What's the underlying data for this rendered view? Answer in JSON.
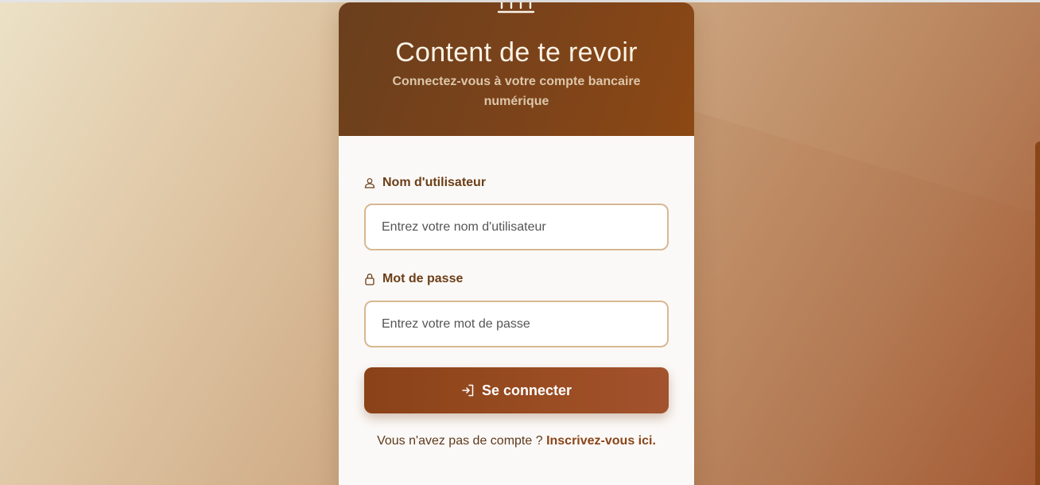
{
  "colors": {
    "accent": "#8a4518",
    "header_start": "#6a3f1d",
    "header_end": "#8c4814",
    "input_border": "#d8b892",
    "label_text": "#6b3e17"
  },
  "header": {
    "icon": "bank-icon",
    "title": "Content de te revoir",
    "subtitle": "Connectez-vous à votre compte bancaire numérique"
  },
  "form": {
    "username": {
      "icon": "user-icon",
      "label": "Nom d'utilisateur",
      "placeholder": "Entrez votre nom d'utilisateur",
      "value": ""
    },
    "password": {
      "icon": "lock-icon",
      "label": "Mot de passe",
      "placeholder": "Entrez votre mot de passe",
      "value": ""
    },
    "submit": {
      "icon": "login-icon",
      "label": "Se connecter"
    }
  },
  "footer": {
    "prompt": "Vous n'avez pas de compte ?",
    "link_label": "Inscrivez-vous ici."
  }
}
